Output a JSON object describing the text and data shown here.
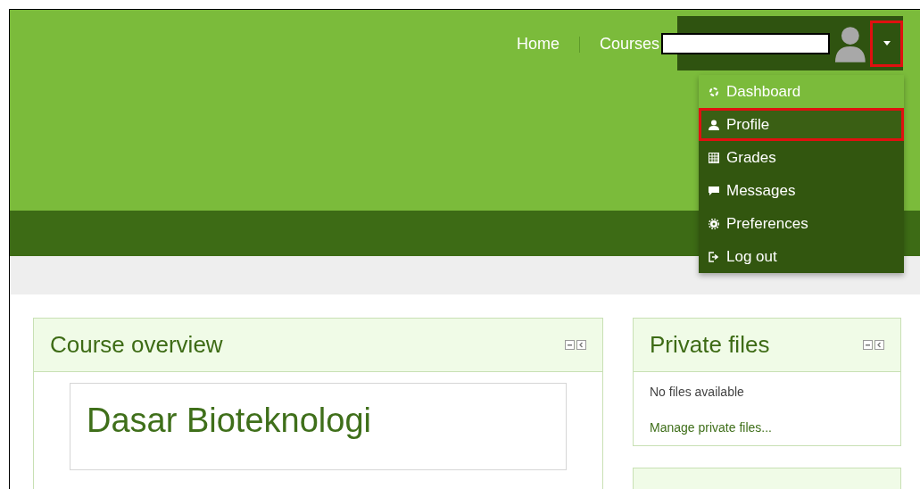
{
  "nav": {
    "links": [
      {
        "label": "Home"
      },
      {
        "label": "Courses"
      }
    ]
  },
  "user_menu": {
    "items": [
      {
        "kind": "dashboard",
        "label": "Dashboard",
        "selected": true,
        "highlighted": false
      },
      {
        "kind": "profile",
        "label": "Profile",
        "selected": false,
        "highlighted": true
      },
      {
        "kind": "grades",
        "label": "Grades",
        "selected": false,
        "highlighted": false
      },
      {
        "kind": "messages",
        "label": "Messages",
        "selected": false,
        "highlighted": false
      },
      {
        "kind": "preferences",
        "label": "Preferences",
        "selected": false,
        "highlighted": false
      },
      {
        "kind": "logout",
        "label": "Log out",
        "selected": false,
        "highlighted": false
      }
    ],
    "toggle_highlighted": true
  },
  "blocks": {
    "course_overview": {
      "title": "Course overview",
      "courses": [
        {
          "name": "Dasar Bioteknologi"
        }
      ]
    },
    "private_files": {
      "title": "Private files",
      "empty_text": "No files available",
      "link": "Manage private files..."
    }
  }
}
